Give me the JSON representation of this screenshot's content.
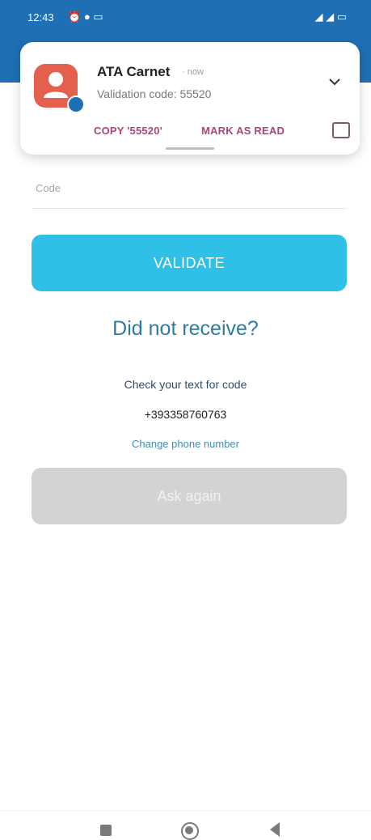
{
  "statusbar": {
    "time": "12:43",
    "icons_left": [
      "alarm-icon",
      "location-icon",
      "cast-icon"
    ],
    "icons_right": [
      "signal-icon",
      "signal-icon",
      "battery-icon"
    ]
  },
  "notification": {
    "app_name": "ATA Carnet",
    "time": "· now",
    "body": "Validation code: 55520",
    "actions": {
      "copy": "COPY '55520'",
      "mark_read": "MARK AS READ"
    }
  },
  "form": {
    "code_label": "Code",
    "validate_label": "VALIDATE",
    "did_not_receive": "Did not receive?",
    "check_text": "Check your text for code",
    "phone_number": "+393358760763",
    "change_phone": "Change phone number",
    "ask_again": "Ask again"
  },
  "colors": {
    "header": "#1f6fb5",
    "validate_button": "#2ec0e6",
    "ask_button_disabled": "#d3d3d3",
    "link": "#3f8fb6",
    "notification_action": "#b0437a",
    "avatar": "#e45f4d"
  },
  "navbar": {
    "icons": [
      "recent-apps-icon",
      "home-icon",
      "back-icon"
    ]
  }
}
